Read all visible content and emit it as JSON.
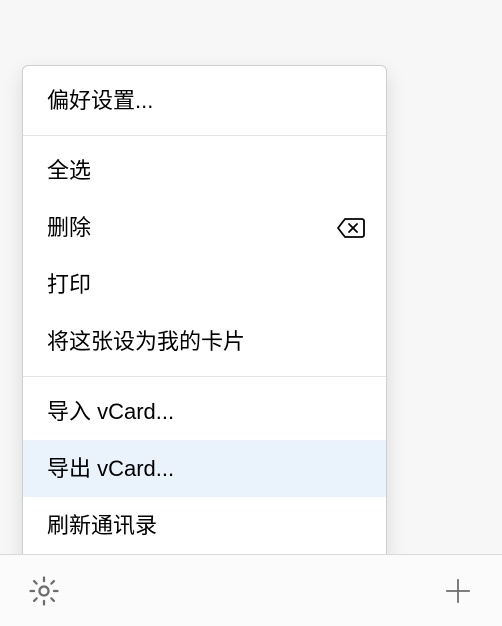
{
  "menu": {
    "sections": [
      {
        "items": [
          {
            "label": "偏好设置...",
            "name": "menu-preferences",
            "icon": null
          }
        ]
      },
      {
        "items": [
          {
            "label": "全选",
            "name": "menu-select-all",
            "icon": null
          },
          {
            "label": "删除",
            "name": "menu-delete",
            "icon": "backspace"
          },
          {
            "label": "打印",
            "name": "menu-print",
            "icon": null
          },
          {
            "label": "将这张设为我的卡片",
            "name": "menu-set-my-card",
            "icon": null
          }
        ]
      },
      {
        "items": [
          {
            "label": "导入 vCard...",
            "name": "menu-import-vcard",
            "icon": null
          },
          {
            "label": "导出 vCard...",
            "name": "menu-export-vcard",
            "icon": null,
            "highlight": true
          },
          {
            "label": "刷新通讯录",
            "name": "menu-refresh-contacts",
            "icon": null
          }
        ]
      }
    ]
  },
  "toolbar": {
    "settings_name": "settings-button",
    "add_name": "add-button"
  }
}
